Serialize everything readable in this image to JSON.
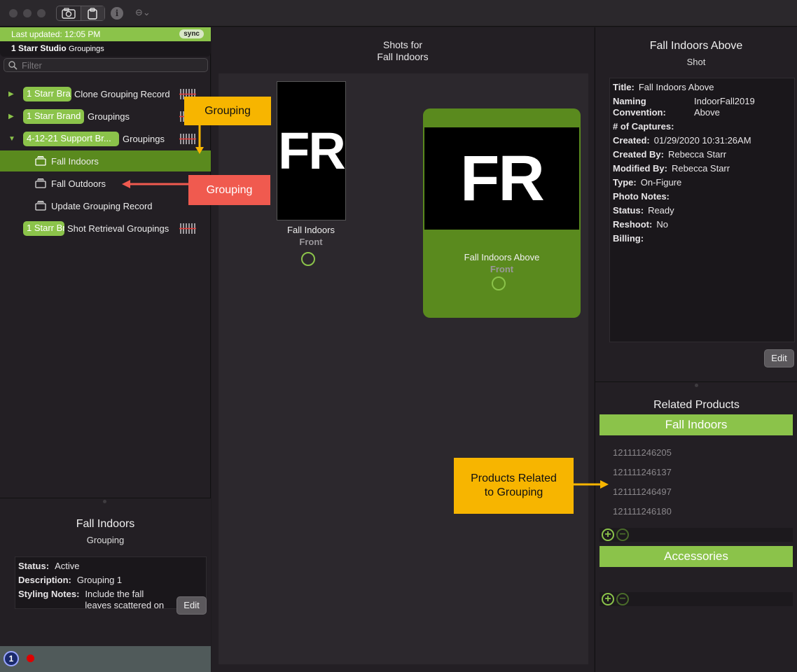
{
  "toolbar": {
    "camera_icon": "camera-icon",
    "clipboard_icon": "clipboard-icon",
    "info_glyph": "i",
    "more_glyph": "⊖⌄"
  },
  "sidebar": {
    "status": "Last updated: 12:05 PM",
    "sync": "sync",
    "studio_bold": "1 Starr Studio",
    "studio_suffix": "Groupings",
    "filter_placeholder": "Filter",
    "tree": [
      {
        "pill": "1 Starr Bra",
        "label": "Clone Grouping Record"
      },
      {
        "pill": "1 Starr Brand",
        "label": "Groupings"
      },
      {
        "pill": "4-12-21 Support Br...",
        "label": "Groupings"
      },
      {
        "label": "Fall Indoors"
      },
      {
        "label": "Fall Outdoors"
      },
      {
        "label": "Update Grouping Record"
      },
      {
        "pill": "1 Starr Br",
        "label": "Shot Retrieval Groupings"
      }
    ]
  },
  "grouping_info": {
    "title": "Fall Indoors",
    "subtitle": "Grouping",
    "status_k": "Status:",
    "status_v": "Active",
    "desc_k": "Description:",
    "desc_v": "Grouping 1",
    "notes_k": "Styling Notes:",
    "notes_v1": "Include the fall",
    "notes_v2": "leaves scattered on",
    "edit": "Edit"
  },
  "shots": {
    "title_line1": "Shots for",
    "title_line2": "Fall Indoors",
    "items": [
      {
        "thumb": "FR",
        "name": "Fall Indoors",
        "view": "Front"
      },
      {
        "thumb": "FR",
        "name": "Fall Indoors Above",
        "view": "Front"
      }
    ]
  },
  "shot_detail": {
    "title": "Fall Indoors Above",
    "subtitle": "Shot",
    "fields": {
      "title_k": "Title:",
      "title_v": "Fall Indoors Above",
      "naming_k1": "Naming",
      "naming_k2": "Convention:",
      "naming_v1": "IndoorFall2019",
      "naming_v2": "Above",
      "captures_k": "# of Captures:",
      "created_k": "Created:",
      "created_v": "01/29/2020 10:31:26AM",
      "createdby_k": "Created By:",
      "createdby_v": "Rebecca Starr",
      "modifiedby_k": "Modified By:",
      "modifiedby_v": "Rebecca Starr",
      "type_k": "Type:",
      "type_v": "On-Figure",
      "photonotes_k": "Photo Notes:",
      "status_k": "Status:",
      "status_v": "Ready",
      "reshoot_k": "Reshoot:",
      "reshoot_v": "No",
      "billing_k": "Billing:"
    },
    "edit": "Edit"
  },
  "related": {
    "title": "Related Products",
    "groups": [
      {
        "name": "Fall Indoors",
        "products": [
          "121111246205",
          "121111246137",
          "121111246497",
          "121111246180"
        ]
      },
      {
        "name": "Accessories",
        "products": []
      }
    ],
    "plus": "+",
    "minus": "−"
  },
  "annotations": {
    "grouping_top": "Grouping",
    "grouping_mid": "Grouping",
    "products_line1": "Products Related",
    "products_line2": "to Grouping"
  },
  "footer": {
    "badge": "1"
  },
  "colors": {
    "accent_green": "#8bc34a",
    "selected_green": "#5a8a1e",
    "callout_orange": "#f7b500",
    "callout_red": "#f05a4f"
  }
}
